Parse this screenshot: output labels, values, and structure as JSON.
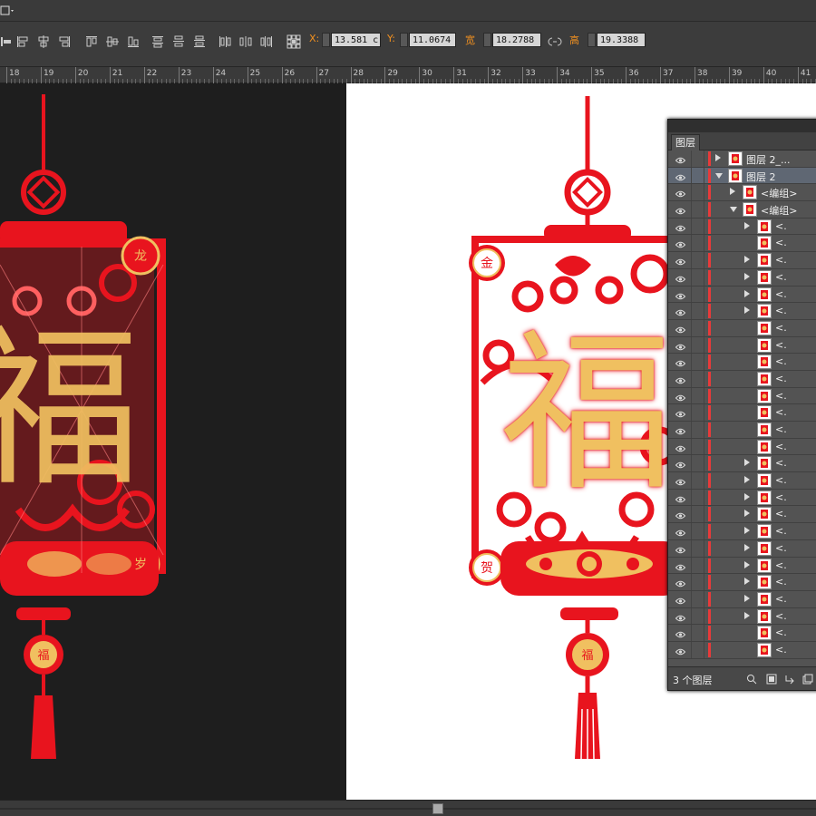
{
  "toolbar": {
    "x_label": "X:",
    "x_value": "13.581 c",
    "y_label": "Y:",
    "y_value": "11.0674",
    "width_label": "宽",
    "width_value": "18.2788",
    "height_label": "高",
    "height_value": "19.3388"
  },
  "ruler": {
    "ticks": [
      "18",
      "19",
      "20",
      "21",
      "22",
      "23",
      "24",
      "25",
      "26",
      "27",
      "28",
      "29",
      "30",
      "31",
      "32",
      "33",
      "34",
      "35",
      "36",
      "37",
      "38",
      "39",
      "40",
      "41"
    ]
  },
  "artwork_dark": {
    "top_char": "龙",
    "bottom_char": "岁",
    "main_char": "福",
    "coin_char": "福"
  },
  "artwork_white": {
    "top_char": "金",
    "bottom_char": "贺",
    "main_char": "福",
    "coin_char": "福"
  },
  "colors": {
    "red": "#e8141e",
    "gold": "#f0c060",
    "selection": "#5f6773",
    "accent_orange": "#f09020"
  },
  "layers_panel": {
    "tab": "图层",
    "footer_count": "3 个图层",
    "rows": [
      {
        "name": "图层 2_...",
        "indent": 0,
        "expand": "right",
        "selected": false
      },
      {
        "name": "图层 2",
        "indent": 0,
        "expand": "down",
        "selected": true
      },
      {
        "name": "<编组>",
        "indent": 1,
        "expand": "right",
        "selected": false
      },
      {
        "name": "<编组>",
        "indent": 1,
        "expand": "down",
        "selected": false
      },
      {
        "name": "<.",
        "indent": 2,
        "expand": "right",
        "selected": false
      },
      {
        "name": "<.",
        "indent": 2,
        "expand": "none",
        "selected": false
      },
      {
        "name": "<.",
        "indent": 2,
        "expand": "right",
        "selected": false
      },
      {
        "name": "<.",
        "indent": 2,
        "expand": "right",
        "selected": false
      },
      {
        "name": "<.",
        "indent": 2,
        "expand": "right",
        "selected": false
      },
      {
        "name": "<.",
        "indent": 2,
        "expand": "right",
        "selected": false
      },
      {
        "name": "<.",
        "indent": 2,
        "expand": "none",
        "selected": false
      },
      {
        "name": "<.",
        "indent": 2,
        "expand": "none",
        "selected": false
      },
      {
        "name": "<.",
        "indent": 2,
        "expand": "none",
        "selected": false
      },
      {
        "name": "<.",
        "indent": 2,
        "expand": "none",
        "selected": false
      },
      {
        "name": "<.",
        "indent": 2,
        "expand": "none",
        "selected": false
      },
      {
        "name": "<.",
        "indent": 2,
        "expand": "none",
        "selected": false
      },
      {
        "name": "<.",
        "indent": 2,
        "expand": "none",
        "selected": false
      },
      {
        "name": "<.",
        "indent": 2,
        "expand": "none",
        "selected": false
      },
      {
        "name": "<.",
        "indent": 2,
        "expand": "right",
        "selected": false
      },
      {
        "name": "<.",
        "indent": 2,
        "expand": "right",
        "selected": false
      },
      {
        "name": "<.",
        "indent": 2,
        "expand": "right",
        "selected": false
      },
      {
        "name": "<.",
        "indent": 2,
        "expand": "right",
        "selected": false
      },
      {
        "name": "<.",
        "indent": 2,
        "expand": "right",
        "selected": false
      },
      {
        "name": "<.",
        "indent": 2,
        "expand": "right",
        "selected": false
      },
      {
        "name": "<.",
        "indent": 2,
        "expand": "right",
        "selected": false
      },
      {
        "name": "<.",
        "indent": 2,
        "expand": "right",
        "selected": false
      },
      {
        "name": "<.",
        "indent": 2,
        "expand": "right",
        "selected": false
      },
      {
        "name": "<.",
        "indent": 2,
        "expand": "right",
        "selected": false
      },
      {
        "name": "<.",
        "indent": 2,
        "expand": "none",
        "selected": false
      },
      {
        "name": "<.",
        "indent": 2,
        "expand": "none",
        "selected": false
      }
    ]
  }
}
